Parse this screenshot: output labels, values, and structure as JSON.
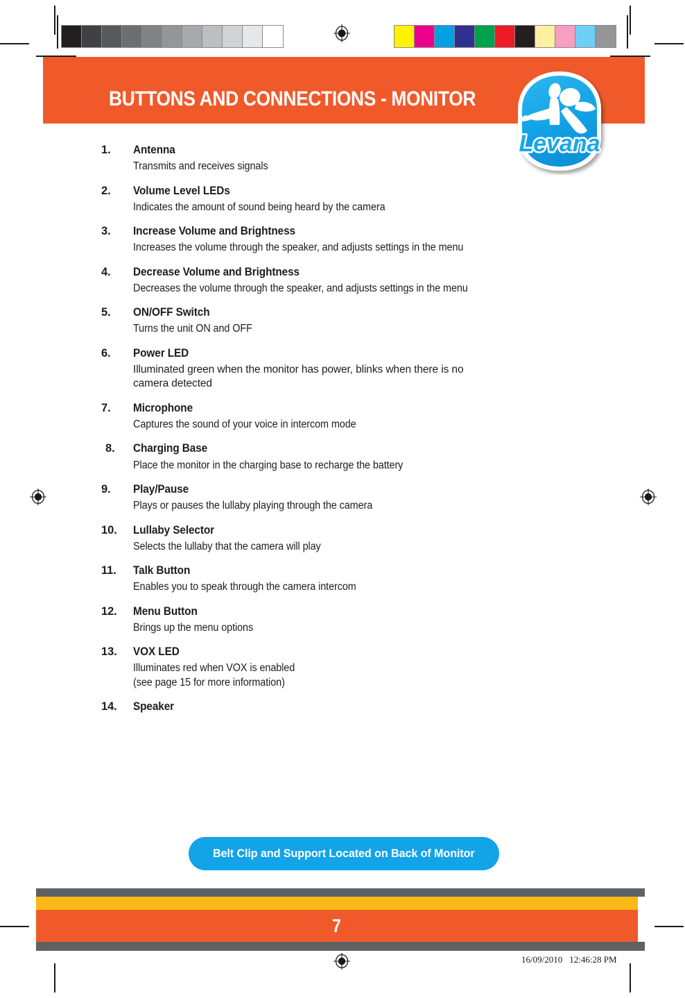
{
  "header": {
    "title": "BUTTONS AND CONNECTIONS - MONITOR",
    "banner_color": "#f05a2a"
  },
  "logo": {
    "name": "levana-logo",
    "wordmark": "Levana",
    "badge_color": "#12a3e8"
  },
  "main": {
    "items": [
      {
        "number": "1.",
        "title": "Antenna",
        "description": [
          "Transmits and receives signals"
        ]
      },
      {
        "number": "2.",
        "title": "Volume Level LEDs",
        "description": [
          "Indicates the amount of sound being heard by the camera"
        ]
      },
      {
        "number": "3.",
        "title": "Increase Volume and Brightness",
        "description": [
          "Increases the volume through the speaker, and adjusts settings in the menu"
        ]
      },
      {
        "number": "4.",
        "title": "Decrease Volume and Brightness",
        "description": [
          "Decreases the volume through the speaker, and adjusts settings in the menu"
        ]
      },
      {
        "number": "5.",
        "title": "ON/OFF Switch",
        "description": [
          "Turns the unit ON and OFF"
        ]
      },
      {
        "number": "6.",
        "title": "Power LED",
        "description": [
          "Illuminated green when the monitor has power, blinks when there is no",
          "camera detected"
        ],
        "justified": true
      },
      {
        "number": "7.",
        "title": "Microphone",
        "description": [
          "Captures the sound of your voice in intercom mode"
        ]
      },
      {
        "number": "8.",
        "title": "Charging Base",
        "description": [
          "Place the monitor in the charging base to recharge the battery"
        ]
      },
      {
        "number": "9.",
        "title": "Play/Pause",
        "description": [
          "Plays or pauses the lullaby playing through the camera"
        ]
      },
      {
        "number": "10.",
        "title": "Lullaby Selector",
        "description": [
          "Selects the lullaby that the camera will play"
        ]
      },
      {
        "number": "11.",
        "title": "Talk Button",
        "description": [
          "Enables you to speak through the camera intercom"
        ]
      },
      {
        "number": "12.",
        "title": "Menu Button",
        "description": [
          "Brings up the menu options"
        ]
      },
      {
        "number": "13.",
        "title": "VOX LED",
        "description": [
          "Illuminates red when VOX is enabled",
          "(see page 15 for more information)"
        ]
      },
      {
        "number": "14.",
        "title": "Speaker",
        "description": []
      }
    ]
  },
  "callout": {
    "label": "Belt Clip and Support Located on Back of Monitor",
    "color": "#12a3e8"
  },
  "footer": {
    "page_number": "7",
    "gray_color": "#5f6265",
    "gold_color": "#fcb816",
    "orange_color": "#f05a2a"
  },
  "print_marks": {
    "timestamp_date": "16/09/2010",
    "timestamp_time": "12:46:28 PM",
    "grayscale_bar": [
      "#231f20",
      "#414042",
      "#58595b",
      "#6d6e70",
      "#808285",
      "#939598",
      "#a7a9ac",
      "#bcbec0",
      "#d1d3d4",
      "#e6e7e8",
      "#ffffff"
    ],
    "color_bar": [
      "#fff200",
      "#ec008c",
      "#00a0e3",
      "#2e3192",
      "#00a14b",
      "#ed1c24",
      "#231f20",
      "#fdf0a0",
      "#f79fc0",
      "#6dcff6",
      "#939598"
    ]
  }
}
